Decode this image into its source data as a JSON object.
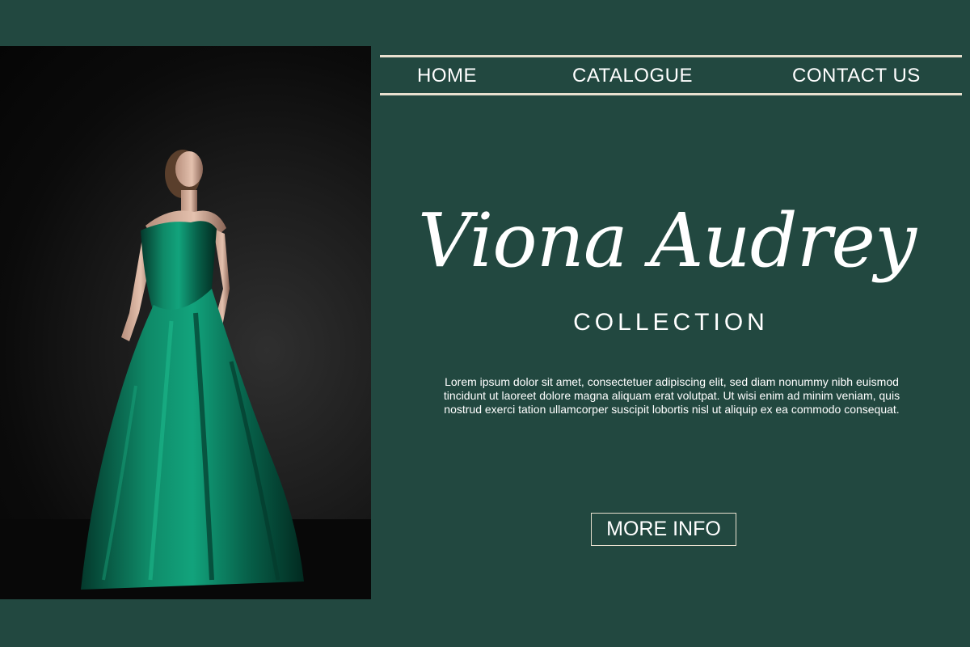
{
  "nav": {
    "home_label": "HOME",
    "catalogue_label": "CATALOGUE",
    "contact_label": "CONTACT US"
  },
  "brand": {
    "title": "Viona Audrey",
    "subtitle": "COLLECTION"
  },
  "description": "Lorem ipsum dolor sit amet, consectetuer adipiscing elit, sed diam nonummy nibh euismod tincidunt ut laoreet dolore magna aliquam erat volutpat. Ut wisi enim ad minim veniam, quis nostrud exerci tation ullamcorper suscipit lobortis nisl ut aliquip ex ea commodo consequat.",
  "cta": {
    "more_info_label": "MORE INFO"
  },
  "colors": {
    "background": "#224840",
    "nav_rule": "#e8e0cf",
    "dress": "#0e7a5e",
    "text": "#ffffff"
  }
}
